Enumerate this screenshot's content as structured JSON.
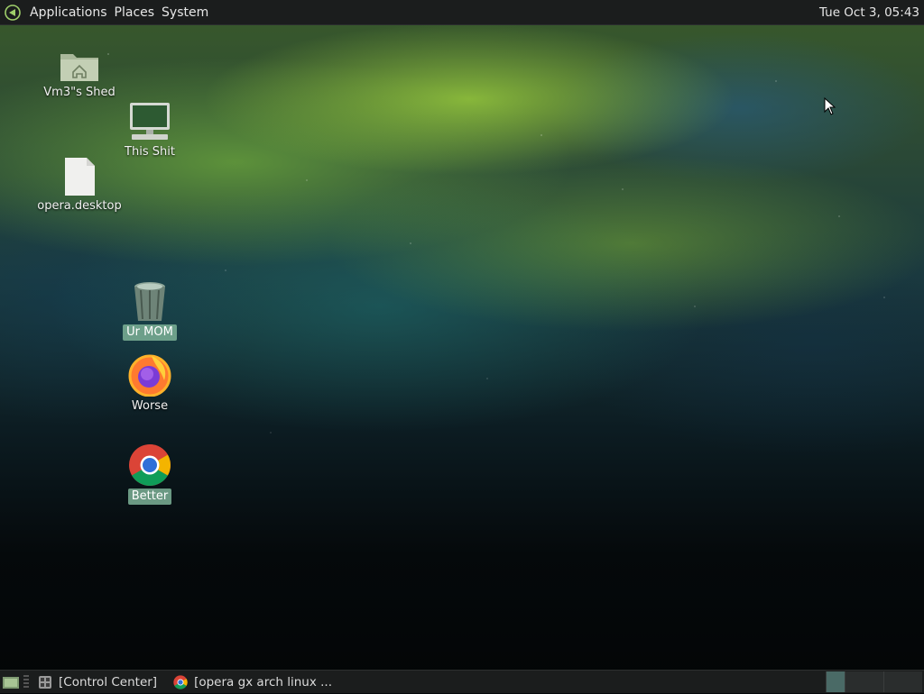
{
  "top_panel": {
    "menus": [
      "Applications",
      "Places",
      "System"
    ],
    "clock": "Tue Oct  3, 05:43"
  },
  "desktop": {
    "icons": [
      {
        "label": "Vm3\"s Shed",
        "icon": "home-folder-icon",
        "selected": false
      },
      {
        "label": "This Shit",
        "icon": "computer-icon",
        "selected": false
      },
      {
        "label": "opera.desktop",
        "icon": "file-icon",
        "selected": false
      },
      {
        "label": "Ur MOM",
        "icon": "trash-icon",
        "selected": true
      },
      {
        "label": "Worse",
        "icon": "firefox-icon",
        "selected": false
      },
      {
        "label": "Better",
        "icon": "chrome-icon",
        "selected": true
      }
    ]
  },
  "bottom_panel": {
    "tasks": [
      {
        "label": "[Control Center]",
        "icon": "control-center-icon"
      },
      {
        "label": "[opera gx arch linux ...",
        "icon": "chrome-icon"
      }
    ]
  },
  "colors": {
    "panel_bg": "#1b1d1d",
    "selection": "#7db296"
  }
}
